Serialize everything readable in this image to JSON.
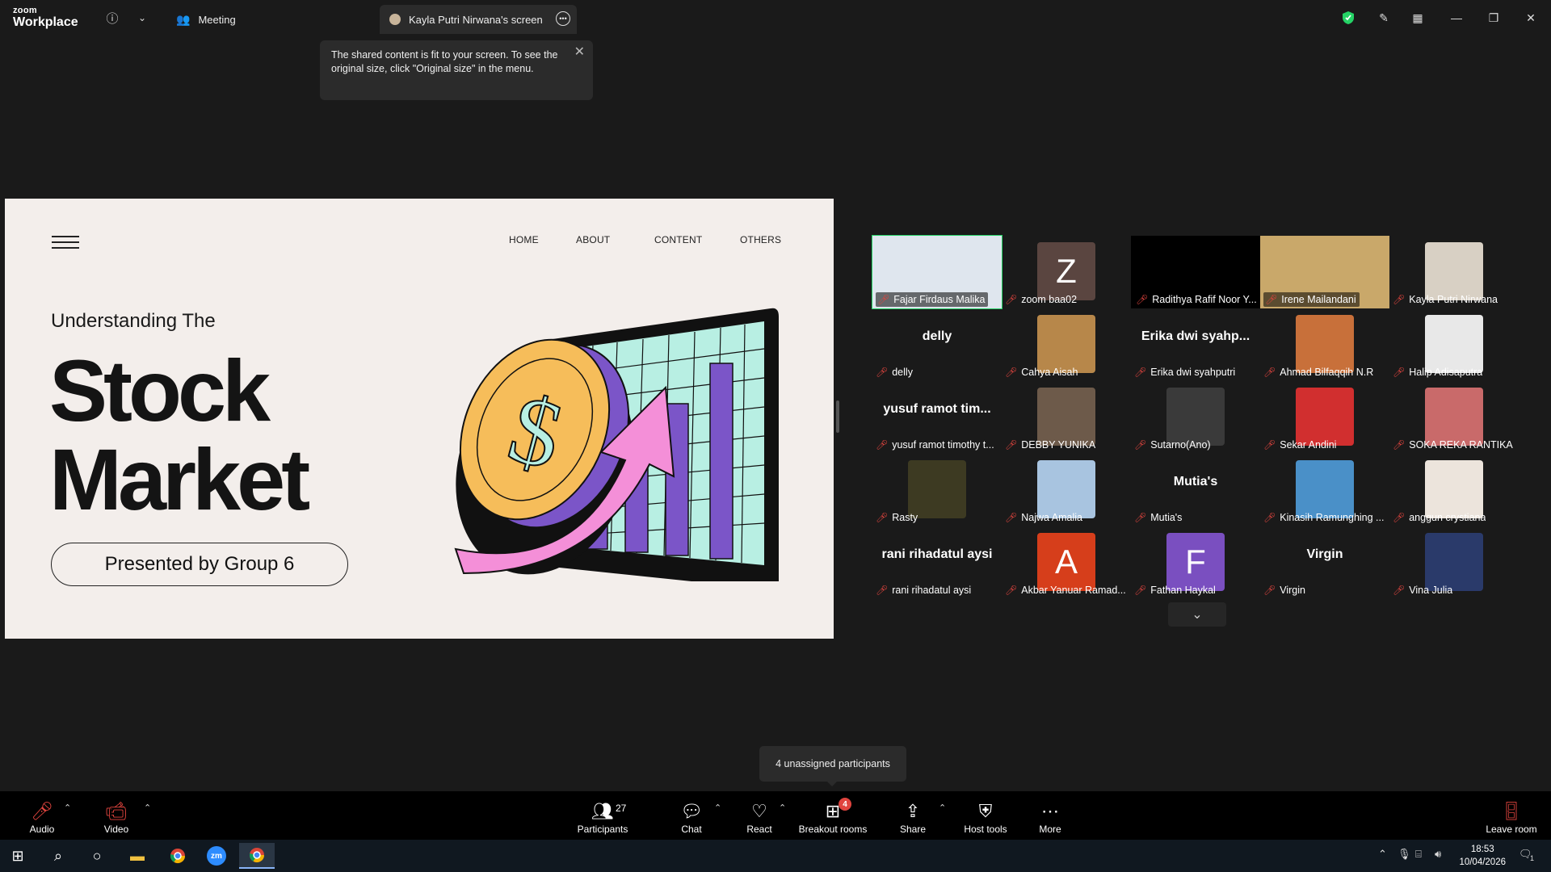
{
  "app": {
    "logo_line1": "zoom",
    "logo_line2": "Workplace"
  },
  "tabs": {
    "meeting": "Meeting",
    "screen": "Kayla Putri Nirwana's screen"
  },
  "tooltip": {
    "text": "The shared content is fit to your screen. To see the original size, click \"Original size\" in the menu."
  },
  "slide": {
    "nav": [
      "HOME",
      "ABOUT",
      "CONTENT",
      "OTHERS"
    ],
    "subtitle": "Understanding The",
    "title_line1": "Stock",
    "title_line2": "Market",
    "presenter": "Presented by Group 6"
  },
  "participants": [
    {
      "name": "Fajar Firdaus Malika",
      "type": "video",
      "active": true,
      "bg": "#dfe6ee"
    },
    {
      "name": "zoom baa02",
      "type": "letter",
      "letter": "Z",
      "color": "#5a4540"
    },
    {
      "name": "Radithya Rafif Noor Y...",
      "type": "video",
      "bg": "#000000"
    },
    {
      "name": "Irene Mailandani",
      "type": "video",
      "bg": "#c9a86a"
    },
    {
      "name": "Kayla Putri Nirwana",
      "type": "photo",
      "color": "#d8d0c4"
    },
    {
      "name": "delly",
      "type": "text",
      "display": "delly"
    },
    {
      "name": "Cahya Aisah",
      "type": "photo",
      "color": "#b7874a"
    },
    {
      "name": "Erika dwi syahputri",
      "type": "text",
      "display": "Erika dwi syahp..."
    },
    {
      "name": "Ahmad Bilfaqqih N.R",
      "type": "photo",
      "color": "#c8703a"
    },
    {
      "name": "Halip Adisaputra",
      "type": "photo",
      "color": "#e8e8e8"
    },
    {
      "name": "yusuf ramot timothy t...",
      "type": "text",
      "display": "yusuf ramot tim..."
    },
    {
      "name": "DEBBY YUNIKA",
      "type": "photo",
      "color": "#6d5a4a"
    },
    {
      "name": "Sutarno(Ano)",
      "type": "photo",
      "color": "#3a3a3a"
    },
    {
      "name": "Sekar Andini",
      "type": "photo",
      "color": "#d12f2f"
    },
    {
      "name": "SOKA REKA RANTIKA",
      "type": "photo",
      "color": "#c96a6a"
    },
    {
      "name": "Rasty",
      "type": "photo",
      "color": "#3d3a22"
    },
    {
      "name": "Najwa Amalia",
      "type": "photo",
      "color": "#a8c4e0"
    },
    {
      "name": "Mutia's",
      "type": "text",
      "display": "Mutia's"
    },
    {
      "name": "Kinasih Ramunghing ...",
      "type": "photo",
      "color": "#4a90c8"
    },
    {
      "name": "anggun crystiana",
      "type": "photo",
      "color": "#ece4dc"
    },
    {
      "name": "rani rihadatul aysi",
      "type": "text",
      "display": "rani rihadatul aysi"
    },
    {
      "name": "Akbar Yanuar Ramad...",
      "type": "letter",
      "letter": "A",
      "color": "#d63e1b"
    },
    {
      "name": "Fathan Haykal",
      "type": "letter",
      "letter": "F",
      "color": "#7a4fc0"
    },
    {
      "name": "Virgin",
      "type": "text",
      "display": "Virgin"
    },
    {
      "name": "Vina Julia",
      "type": "photo",
      "color": "#2a3a6a"
    }
  ],
  "unassigned": "4 unassigned participants",
  "toolbar": {
    "audio": "Audio",
    "video": "Video",
    "participants": "Participants",
    "participants_count": "27",
    "chat": "Chat",
    "react": "React",
    "breakout": "Breakout rooms",
    "breakout_badge": "4",
    "share": "Share",
    "host_tools": "Host tools",
    "more": "More",
    "leave": "Leave room"
  },
  "taskbar": {
    "time": "18:53",
    "date": "10/04/2026",
    "notif": "1"
  },
  "colors": {
    "active_border": "#25d366",
    "muted_red": "#e0443e",
    "slide_bg": "#f3eeeb"
  }
}
